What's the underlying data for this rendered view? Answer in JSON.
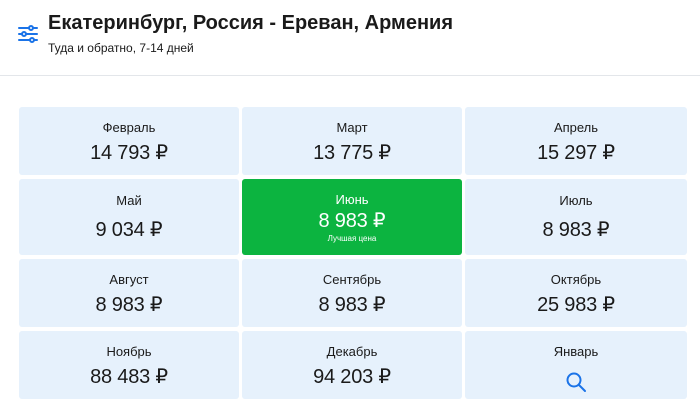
{
  "header": {
    "title": "Екатеринбург, Россия - Ереван, Армения",
    "subtitle": "Туда и обратно, 7-14 дней"
  },
  "colors": {
    "accent": "#1a73e8",
    "cell_bg": "#e6f1fc",
    "best_bg": "#0cb440"
  },
  "months": [
    {
      "label": "Февраль",
      "price": "14 793 ₽"
    },
    {
      "label": "Март",
      "price": "13 775 ₽"
    },
    {
      "label": "Апрель",
      "price": "15 297 ₽"
    },
    {
      "label": "Май",
      "price": "9 034 ₽"
    },
    {
      "label": "Июнь",
      "price": "8 983 ₽",
      "note": "Лучшая цена"
    },
    {
      "label": "Июль",
      "price": "8 983 ₽"
    },
    {
      "label": "Август",
      "price": "8 983 ₽"
    },
    {
      "label": "Сентябрь",
      "price": "8 983 ₽"
    },
    {
      "label": "Октябрь",
      "price": "25 983 ₽"
    },
    {
      "label": "Ноябрь",
      "price": "88 483 ₽"
    },
    {
      "label": "Декабрь",
      "price": "94 203 ₽"
    },
    {
      "label": "Январь",
      "icon": "search-icon"
    }
  ]
}
